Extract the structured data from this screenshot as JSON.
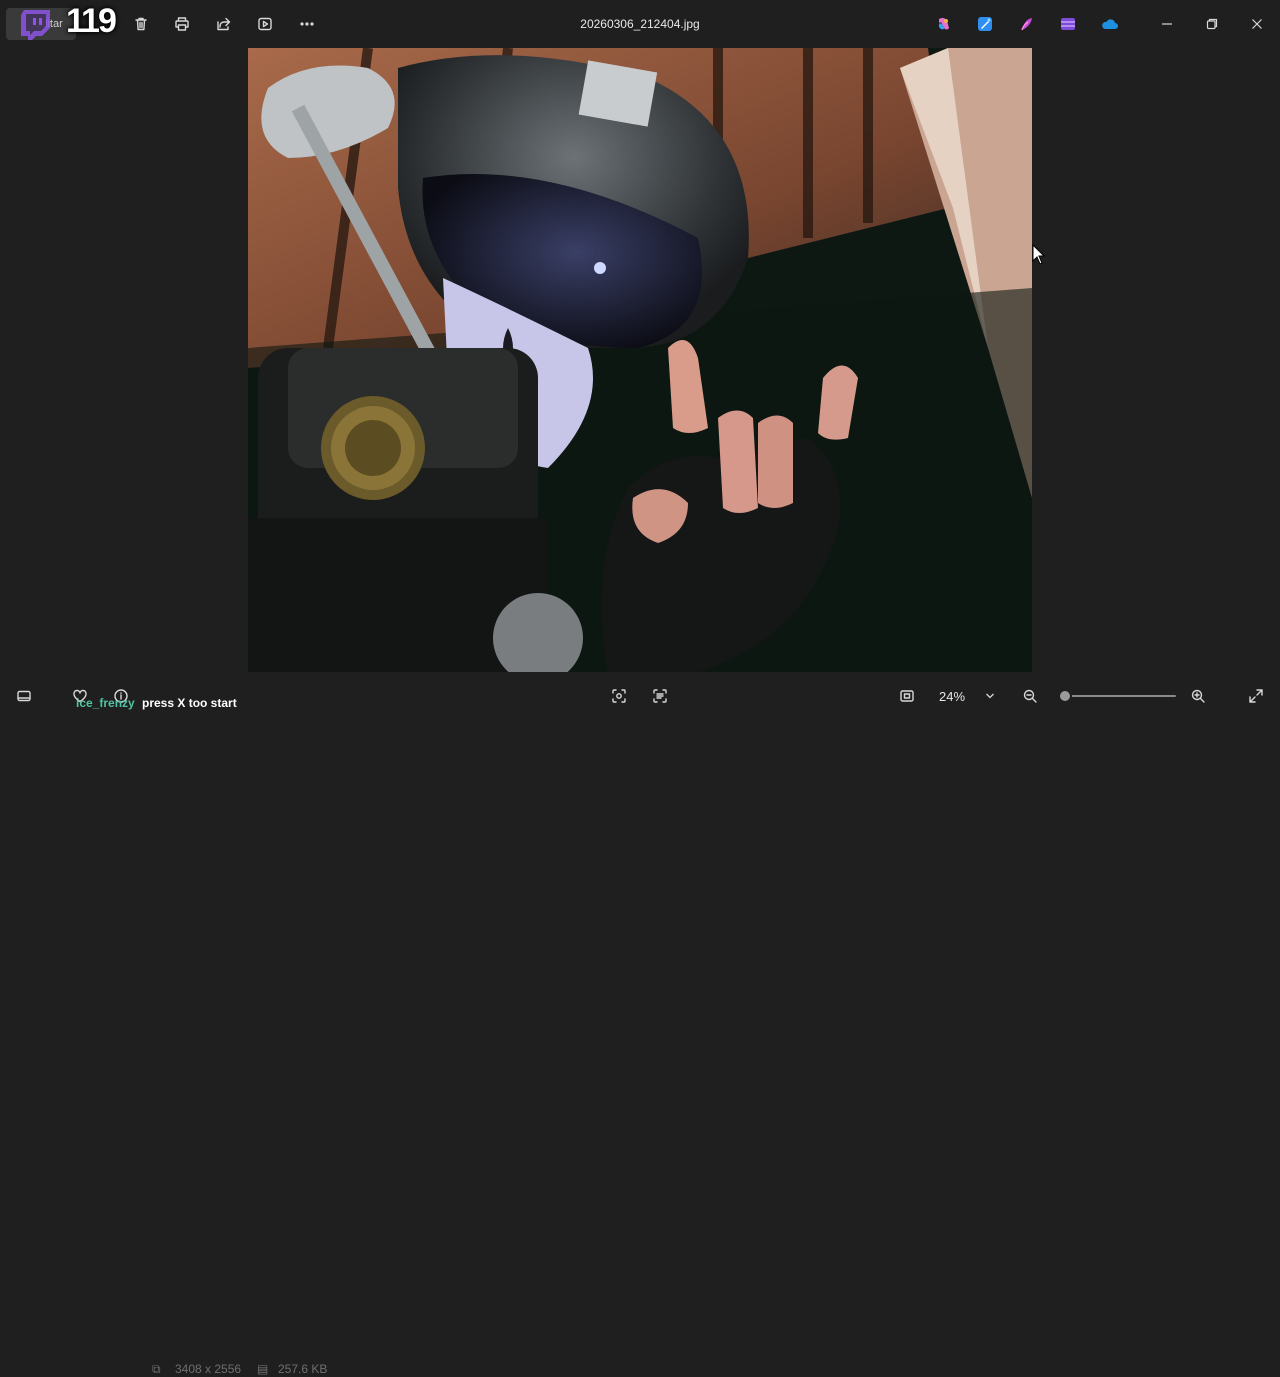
{
  "toolbar": {
    "edit_label": "Editar",
    "overlay_number": "119"
  },
  "window": {
    "title": "20260306_212404.jpg"
  },
  "app_icons": [
    {
      "name": "copilot-icon",
      "color": "#e86fd0"
    },
    {
      "name": "designer-icon",
      "color": "#2f8ef0"
    },
    {
      "name": "paint-icon",
      "color": "#c64bd8"
    },
    {
      "name": "clipchamp-icon",
      "color": "#7c4bd8"
    },
    {
      "name": "onedrive-icon",
      "color": "#1e90e0"
    }
  ],
  "status": {
    "dimensions": "3408 x 2556",
    "file_size": "257.6 KB",
    "zoom": "24%",
    "zoom_level": 0.0
  },
  "chat": {
    "user": "ice_frenzy",
    "message": "press X too start"
  },
  "colors": {
    "background": "#1f1f1f",
    "chat_user": "#4fc3a1"
  }
}
